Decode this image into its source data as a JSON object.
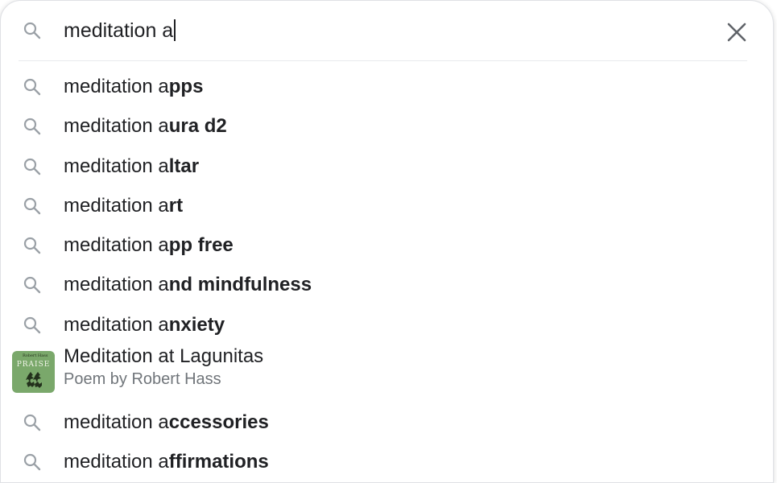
{
  "search": {
    "query": "meditation a",
    "icon": "search-icon",
    "clear_icon": "close-icon"
  },
  "suggestions": [
    {
      "prefix": "meditation a",
      "completion": "pps"
    },
    {
      "prefix": "meditation a",
      "completion": "ura d2"
    },
    {
      "prefix": "meditation a",
      "completion": "ltar"
    },
    {
      "prefix": "meditation a",
      "completion": "rt"
    },
    {
      "prefix": "meditation a",
      "completion": "pp free"
    },
    {
      "prefix": "meditation a",
      "completion": "nd mindfulness"
    },
    {
      "prefix": "meditation a",
      "completion": "nxiety"
    }
  ],
  "entity": {
    "title": "Meditation at Lagunitas",
    "subtitle": "Poem by Robert Hass",
    "thumbnail_text": "PRAISE",
    "thumbnail_small": "Robert Hass"
  },
  "more_suggestions": [
    {
      "prefix": "meditation a",
      "completion": "ccessories"
    },
    {
      "prefix": "meditation a",
      "completion": "ffirmations"
    }
  ],
  "colors": {
    "text": "#202124",
    "secondary": "#70757a",
    "icon": "#9aa0a6",
    "border": "#dfe1e5"
  }
}
